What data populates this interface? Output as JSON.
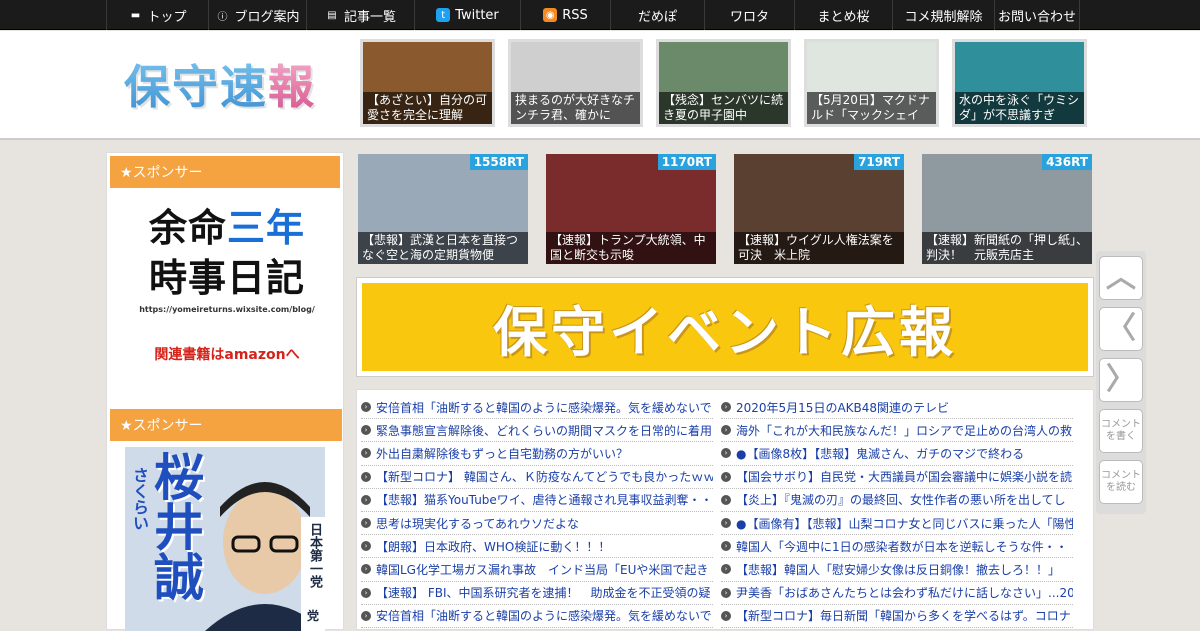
{
  "nav": {
    "items": [
      {
        "label": "トップ",
        "icon": "home-icon",
        "glyph": "▬"
      },
      {
        "label": "ブログ案内",
        "icon": "info-icon",
        "glyph": "ⓘ"
      },
      {
        "label": "記事一覧",
        "icon": "list-icon",
        "glyph": "▤"
      },
      {
        "label": "Twitter",
        "icon": "twitter-icon",
        "glyph": "t"
      },
      {
        "label": "RSS",
        "icon": "rss-icon",
        "glyph": "◉"
      },
      {
        "label": "だめぽ",
        "icon": "",
        "glyph": ""
      },
      {
        "label": "ワロタ",
        "icon": "",
        "glyph": ""
      },
      {
        "label": "まとめ桜",
        "icon": "",
        "glyph": ""
      },
      {
        "label": "コメ規制解除",
        "icon": "",
        "glyph": ""
      },
      {
        "label": "お問い合わせ",
        "icon": "",
        "glyph": ""
      }
    ]
  },
  "header": {
    "logo": {
      "part1": "保守",
      "part2": "速",
      "part3": "報"
    },
    "thumbs": [
      {
        "caption": "【あざとい】自分の可愛さを完全に理解",
        "bg": "#8a5a2e"
      },
      {
        "caption": "挟まるのが大好きなチンチラ君、確かに",
        "bg": "#cfcfcf"
      },
      {
        "caption": "【残念】センバツに続き夏の甲子園中",
        "bg": "#6a8a6a"
      },
      {
        "caption": "【5月20日】マクドナルド「マックシェイ",
        "bg": "#dfe6e0"
      },
      {
        "caption": "水の中を泳ぐ「ウミシダ」が不思議すぎ",
        "bg": "#2f8f9a"
      }
    ]
  },
  "sidebar": {
    "sponsor1": "★スポンサー",
    "ad1": {
      "line1a": "余命",
      "line1b": "三年",
      "line2": "時事日記",
      "url": "https://yomeireturns.wixsite.com/blog/",
      "book": "関連書籍はamazonへ"
    },
    "sponsor2": "★スポンサー",
    "ad2": {
      "name_big": "桜井誠",
      "name_ruby": "さくらい",
      "party": "日本第一党",
      "party_tail": "党"
    }
  },
  "rt_items": [
    {
      "rt": "1558RT",
      "caption": "【悲報】武漢と日本を直接つなぐ空と海の定期貨物便",
      "bg": "#9aa9b8"
    },
    {
      "rt": "1170RT",
      "caption": "【速報】トランプ大統領、中国と断交も示唆",
      "bg": "#7a2b2b"
    },
    {
      "rt": "719RT",
      "caption": "【速報】ウイグル人権法案を可決　米上院",
      "bg": "#5a4030"
    },
    {
      "rt": "436RT",
      "caption": "【速報】新聞紙の「押し紙」、判決！　元販売店主",
      "bg": "#8f9aa0"
    }
  ],
  "banner": {
    "text": "保守イベント広報"
  },
  "news_left": [
    "安倍首相「油断すると韓国のように感染爆発。気を緩めないで",
    "緊急事態宣言解除後、どれくらいの期間マスクを日常的に着用",
    "外出自粛解除後もずっと自宅勤務の方がいい？",
    "【新型コロナ】 韓国さん、Ｋ防疫なんてどうでも良かったｗｗ",
    "【悲報】猫系YouTubeワイ、虐待と通報され見事収益剥奪・・",
    "思考は現実化するってあれウソだよな",
    "【朗報】日本政府、WHO検証に動く！！！",
    "韓国LG化学工場ガス漏れ事故　インド当局「EUや米国で起き",
    "【速報】 FBI、中国系研究者を逮捕！　助成金を不正受領の疑",
    "安倍首相「油断すると韓国のように感染爆発。気を緩めないで"
  ],
  "news_right": [
    "2020年5月15日のAKB48関連のテレビ",
    "海外「これが大和民族なんだ！」ロシアで足止めの台湾人の救",
    "●【画像8枚】【悲報】鬼滅さん、ガチのマジで終わる",
    "【国会サボり】自民党・大西議員が国会審議中に娯楽小説を読",
    "【炎上】『鬼滅の刃』の最終回、女性作者の悪い所を出してし",
    "●【画像有】【悲報】山梨コロナ女と同じバスに乗った人「陽性",
    "韓国人「今週中に1日の感染者数が日本を逆転しそうな件・・",
    "【悲報】韓国人「慰安婦少女像は反日銅像！撤去しろ！！」",
    "尹美香「おばあさんたちとは会わず私だけに話しなさい」...20",
    "【新型コロナ】毎日新聞「韓国から多くを学べるはず。コロナ"
  ],
  "float": [
    {
      "icon": "chevron-up-icon",
      "glyph": "︿",
      "label": ""
    },
    {
      "icon": "chevron-left-icon",
      "glyph": "〈",
      "label": ""
    },
    {
      "icon": "chevron-right-icon",
      "glyph": "〉",
      "label": ""
    },
    {
      "icon": "comment-write-icon",
      "glyph": "",
      "label": "コメントを書く"
    },
    {
      "icon": "comment-read-icon",
      "glyph": "",
      "label": "コメントを読む"
    }
  ]
}
